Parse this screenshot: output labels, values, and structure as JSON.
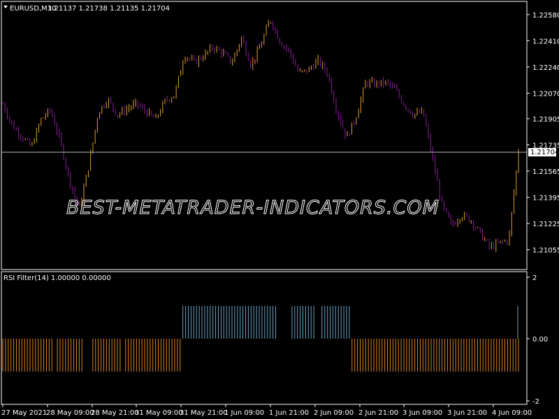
{
  "window": {
    "symbol_title": "EURUSD,M30",
    "ohlc": "1.21137 1.21738 1.21135 1.21704",
    "dropdown_icon": "triangle-down-icon"
  },
  "watermark": "BEST-METATRADER-INDICATORS.COM",
  "colors": {
    "background": "#000000",
    "grid": "#ffffff",
    "bull": "#e0a030",
    "bear": "#8a1e9a",
    "price_line": "#c0c0c0",
    "price_tag_bg": "#ffffff",
    "price_tag_text": "#000000",
    "rsi_up": "#6aa2c6",
    "rsi_down": "#d9862a"
  },
  "price_axis": {
    "ticks": [
      "1.22580",
      "1.22410",
      "1.22240",
      "1.22070",
      "1.21905",
      "1.21735",
      "1.21565",
      "1.21395",
      "1.21225",
      "1.21055"
    ],
    "current_price": "1.21704"
  },
  "indicator": {
    "title": "RSI Filter(14) 1.00000 0.00000",
    "axis_ticks": [
      "2",
      "0.00",
      "-2"
    ]
  },
  "time_axis": {
    "labels": [
      "27 May 2021",
      "28 May 09:00",
      "28 May 21:00",
      "31 May 09:00",
      "31 May 21:00",
      "1 Jun 09:00",
      "1 Jun 21:00",
      "2 Jun 09:00",
      "2 Jun 21:00",
      "3 Jun 09:00",
      "3 Jun 21:00",
      "4 Jun 09:00"
    ]
  },
  "chart_data": {
    "type": "candlestick",
    "symbol": "EURUSD",
    "timeframe": "M30",
    "ylim": [
      1.2099,
      1.2262
    ],
    "price_series": [
      {
        "x": "27 May 2021",
        "y": 1.22
      },
      {
        "x": "27 May 2021",
        "y": 1.2186
      },
      {
        "x": "27 May",
        "y": 1.2179
      },
      {
        "x": "27 May",
        "y": 1.2172
      },
      {
        "x": "27 May",
        "y": 1.219
      },
      {
        "x": "27 May",
        "y": 1.2196
      },
      {
        "x": "28 May",
        "y": 1.2176
      },
      {
        "x": "28 May",
        "y": 1.215
      },
      {
        "x": "28 May",
        "y": 1.2132
      },
      {
        "x": "28 May 09:00",
        "y": 1.216
      },
      {
        "x": "28 May",
        "y": 1.2195
      },
      {
        "x": "28 May",
        "y": 1.2203
      },
      {
        "x": "28 May",
        "y": 1.2193
      },
      {
        "x": "28 May 21:00",
        "y": 1.2197
      },
      {
        "x": "28 May",
        "y": 1.22
      },
      {
        "x": "28 May",
        "y": 1.2195
      },
      {
        "x": "31 May",
        "y": 1.219
      },
      {
        "x": "31 May 09:00",
        "y": 1.2202
      },
      {
        "x": "31 May",
        "y": 1.2206
      },
      {
        "x": "31 May",
        "y": 1.2232
      },
      {
        "x": "31 May",
        "y": 1.2227
      },
      {
        "x": "31 May 21:00",
        "y": 1.2231
      },
      {
        "x": "31 May",
        "y": 1.2237
      },
      {
        "x": "1 Jun",
        "y": 1.2233
      },
      {
        "x": "1 Jun",
        "y": 1.2227
      },
      {
        "x": "1 Jun 09:00",
        "y": 1.2243
      },
      {
        "x": "1 Jun",
        "y": 1.2225
      },
      {
        "x": "1 Jun",
        "y": 1.2238
      },
      {
        "x": "1 Jun",
        "y": 1.2255
      },
      {
        "x": "1 Jun",
        "y": 1.2241
      },
      {
        "x": "1 Jun",
        "y": 1.2234
      },
      {
        "x": "1 Jun 21:00",
        "y": 1.222
      },
      {
        "x": "1 Jun",
        "y": 1.2222
      },
      {
        "x": "2 Jun",
        "y": 1.2228
      },
      {
        "x": "2 Jun",
        "y": 1.222
      },
      {
        "x": "2 Jun",
        "y": 1.2195
      },
      {
        "x": "2 Jun 09:00",
        "y": 1.2178
      },
      {
        "x": "2 Jun",
        "y": 1.2192
      },
      {
        "x": "2 Jun",
        "y": 1.2214
      },
      {
        "x": "2 Jun 21:00",
        "y": 1.2213
      },
      {
        "x": "2 Jun",
        "y": 1.2214
      },
      {
        "x": "3 Jun",
        "y": 1.221
      },
      {
        "x": "3 Jun",
        "y": 1.22
      },
      {
        "x": "3 Jun 09:00",
        "y": 1.2193
      },
      {
        "x": "3 Jun",
        "y": 1.2195
      },
      {
        "x": "3 Jun",
        "y": 1.2165
      },
      {
        "x": "3 Jun",
        "y": 1.2134
      },
      {
        "x": "3 Jun 21:00",
        "y": 1.2121
      },
      {
        "x": "3 Jun",
        "y": 1.2128
      },
      {
        "x": "3 Jun",
        "y": 1.2125
      },
      {
        "x": "4 Jun",
        "y": 1.2116
      },
      {
        "x": "4 Jun",
        "y": 1.2107
      },
      {
        "x": "4 Jun 09:00",
        "y": 1.211
      },
      {
        "x": "4 Jun",
        "y": 1.2112
      },
      {
        "x": "4 Jun",
        "y": 1.217
      }
    ],
    "rsi_filter": [
      -1,
      -1,
      -1,
      -1,
      -1,
      -1,
      -1,
      -1,
      -1,
      -1,
      -1,
      -1,
      -1,
      -1,
      -1,
      -1,
      -1,
      -1,
      -1,
      1,
      1,
      1,
      1,
      1,
      1,
      1,
      1,
      1,
      1,
      1,
      1,
      1,
      1,
      1,
      1,
      1,
      1,
      -1,
      -1,
      -1,
      -1,
      -1,
      -1,
      -1,
      -1,
      -1,
      -1,
      -1,
      -1,
      -1,
      -1,
      -1,
      -1,
      -1,
      -1
    ],
    "rsi_ylim": [
      -2,
      2
    ]
  }
}
